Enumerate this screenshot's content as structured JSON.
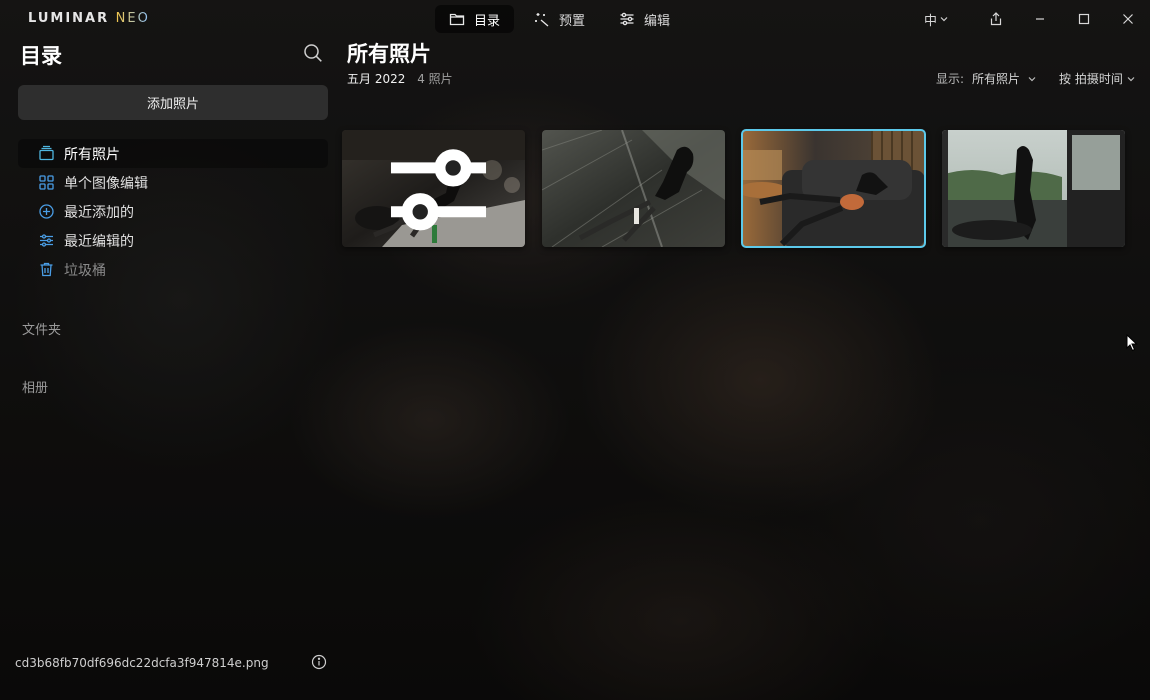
{
  "app": {
    "logo_main": "LUMINAR",
    "logo_sub": "NEO"
  },
  "tabs": [
    {
      "label": "目录",
      "icon": "folder-icon",
      "active": true
    },
    {
      "label": "预置",
      "icon": "magic-wand-icon",
      "active": false
    },
    {
      "label": "编辑",
      "icon": "sliders-icon",
      "active": false
    }
  ],
  "window": {
    "language": "中",
    "buttons": [
      "share-icon",
      "minimize-icon",
      "maximize-icon",
      "close-icon"
    ]
  },
  "sidebar": {
    "title": "目录",
    "add_button": "添加照片",
    "items": [
      {
        "label": "所有照片",
        "icon": "photos-stack-icon",
        "active": true
      },
      {
        "label": "单个图像编辑",
        "icon": "grid-icon",
        "active": false
      },
      {
        "label": "最近添加的",
        "icon": "plus-circle-icon",
        "active": false
      },
      {
        "label": "最近编辑的",
        "icon": "sliders-icon",
        "active": false
      },
      {
        "label": "垃圾桶",
        "icon": "trash-icon",
        "active": false
      }
    ],
    "sections": [
      "文件夹",
      "相册"
    ],
    "footer_filename": "cd3b68fb70df696dc22dcfa3f947814e.png"
  },
  "main": {
    "title": "所有照片",
    "date_group": "五月 2022",
    "count": "4 照片",
    "show_label": "显示:",
    "show_value": "所有照片",
    "sort_value": "按 拍摄时间"
  },
  "photos": [
    {
      "name": "photo-1",
      "edited": true,
      "selected": false
    },
    {
      "name": "photo-2",
      "edited": false,
      "selected": false
    },
    {
      "name": "photo-3",
      "edited": false,
      "selected": true
    },
    {
      "name": "photo-4",
      "edited": false,
      "selected": false
    }
  ],
  "colors": {
    "accent": "#5cc9ea",
    "icon_blue": "#4a9ee6",
    "background": "#121110"
  }
}
